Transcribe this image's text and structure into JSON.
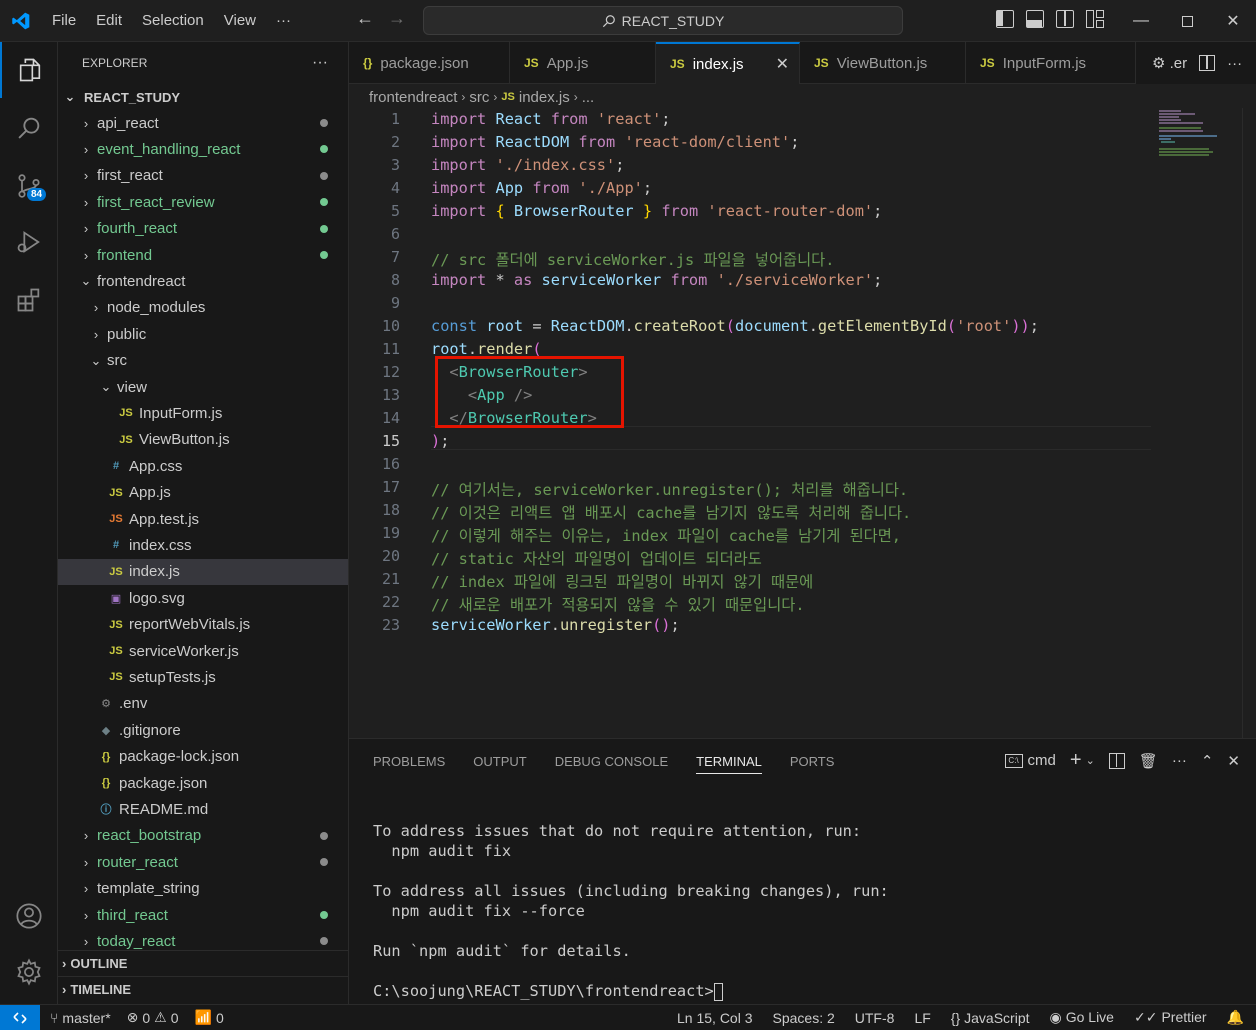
{
  "titlebar": {
    "menu": [
      "File",
      "Edit",
      "Selection",
      "View"
    ],
    "more": "···",
    "search_text": "REACT_STUDY"
  },
  "activitybar": {
    "scm_badge": "84"
  },
  "sidebar": {
    "title": "EXPLORER",
    "more": "···",
    "root": "REACT_STUDY",
    "items": [
      {
        "label": "api_react",
        "type": "folder",
        "level": 0,
        "open": false,
        "color": "#cccccc",
        "dot": "#8b8b8b"
      },
      {
        "label": "event_handling_react",
        "type": "folder",
        "level": 0,
        "open": false,
        "color": "#73c991",
        "dot": "#73c991"
      },
      {
        "label": "first_react",
        "type": "folder",
        "level": 0,
        "open": false,
        "color": "#cccccc",
        "dot": "#8b8b8b"
      },
      {
        "label": "first_react_review",
        "type": "folder",
        "level": 0,
        "open": false,
        "color": "#73c991",
        "dot": "#73c991"
      },
      {
        "label": "fourth_react",
        "type": "folder",
        "level": 0,
        "open": false,
        "color": "#73c991",
        "dot": "#73c991"
      },
      {
        "label": "frontend",
        "type": "folder",
        "level": 0,
        "open": false,
        "color": "#73c991",
        "dot": "#73c991"
      },
      {
        "label": "frontendreact",
        "type": "folder",
        "level": 0,
        "open": true,
        "color": "#cccccc",
        "dot": ""
      },
      {
        "label": "node_modules",
        "type": "folder",
        "level": 1,
        "open": false,
        "color": "#cccccc",
        "dot": ""
      },
      {
        "label": "public",
        "type": "folder",
        "level": 1,
        "open": false,
        "color": "#cccccc",
        "dot": ""
      },
      {
        "label": "src",
        "type": "folder",
        "level": 1,
        "open": true,
        "color": "#cccccc",
        "dot": ""
      },
      {
        "label": "view",
        "type": "folder",
        "level": 2,
        "open": true,
        "color": "#cccccc",
        "dot": ""
      },
      {
        "label": "InputForm.js",
        "type": "js",
        "level": 3,
        "color": "#cccccc",
        "dot": ""
      },
      {
        "label": "ViewButton.js",
        "type": "js",
        "level": 3,
        "color": "#cccccc",
        "dot": ""
      },
      {
        "label": "App.css",
        "type": "css",
        "level": 2,
        "color": "#cccccc",
        "dot": ""
      },
      {
        "label": "App.js",
        "type": "js",
        "level": 2,
        "color": "#cccccc",
        "dot": ""
      },
      {
        "label": "App.test.js",
        "type": "test",
        "level": 2,
        "color": "#cccccc",
        "dot": ""
      },
      {
        "label": "index.css",
        "type": "css",
        "level": 2,
        "color": "#cccccc",
        "dot": ""
      },
      {
        "label": "index.js",
        "type": "js",
        "level": 2,
        "color": "#cccccc",
        "dot": "",
        "selected": true
      },
      {
        "label": "logo.svg",
        "type": "svg",
        "level": 2,
        "color": "#cccccc",
        "dot": ""
      },
      {
        "label": "reportWebVitals.js",
        "type": "js",
        "level": 2,
        "color": "#cccccc",
        "dot": ""
      },
      {
        "label": "serviceWorker.js",
        "type": "js",
        "level": 2,
        "color": "#cccccc",
        "dot": ""
      },
      {
        "label": "setupTests.js",
        "type": "js",
        "level": 2,
        "color": "#cccccc",
        "dot": ""
      },
      {
        "label": ".env",
        "type": "env",
        "level": 1,
        "color": "#cccccc",
        "dot": ""
      },
      {
        "label": ".gitignore",
        "type": "git",
        "level": 1,
        "color": "#cccccc",
        "dot": ""
      },
      {
        "label": "package-lock.json",
        "type": "json",
        "level": 1,
        "color": "#cccccc",
        "dot": ""
      },
      {
        "label": "package.json",
        "type": "json",
        "level": 1,
        "color": "#cccccc",
        "dot": ""
      },
      {
        "label": "README.md",
        "type": "info",
        "level": 1,
        "color": "#cccccc",
        "dot": ""
      },
      {
        "label": "react_bootstrap",
        "type": "folder",
        "level": 0,
        "open": false,
        "color": "#73c991",
        "dot": "#8b8b8b"
      },
      {
        "label": "router_react",
        "type": "folder",
        "level": 0,
        "open": false,
        "color": "#73c991",
        "dot": "#8b8b8b"
      },
      {
        "label": "template_string",
        "type": "folder",
        "level": 0,
        "open": false,
        "color": "#cccccc",
        "dot": ""
      },
      {
        "label": "third_react",
        "type": "folder",
        "level": 0,
        "open": false,
        "color": "#73c991",
        "dot": "#73c991"
      },
      {
        "label": "today_react",
        "type": "folder",
        "level": 0,
        "open": false,
        "color": "#73c991",
        "dot": "#8b8b8b"
      }
    ],
    "outline": "OUTLINE",
    "timeline": "TIMELINE"
  },
  "tabs": [
    {
      "label": "package.json",
      "icon": "{}",
      "icon_color": "#cbcb41",
      "active": false
    },
    {
      "label": "App.js",
      "icon": "JS",
      "icon_color": "#cbcb41",
      "active": false
    },
    {
      "label": "index.js",
      "icon": "JS",
      "icon_color": "#cbcb41",
      "active": true
    },
    {
      "label": "ViewButton.js",
      "icon": "JS",
      "icon_color": "#cbcb41",
      "active": false
    },
    {
      "label": "InputForm.js",
      "icon": "JS",
      "icon_color": "#cbcb41",
      "active": false
    }
  ],
  "tab_overflow": ".er",
  "breadcrumb": [
    "frontendreact",
    "src",
    "index.js",
    "..."
  ],
  "editor": {
    "current_line": 15,
    "lines": [
      [
        [
          "kwc",
          "import "
        ],
        [
          "var",
          "React "
        ],
        [
          "kwc",
          "from "
        ],
        [
          "str",
          "'react'"
        ],
        [
          "",
          "；"
        ]
      ],
      [],
      [],
      [],
      [],
      [],
      [],
      [],
      [],
      [],
      [],
      [],
      [],
      [],
      [],
      [],
      [],
      [],
      [],
      [],
      [],
      [],
      []
    ]
  },
  "code_text": [
    "import React from 'react';",
    "import ReactDOM from 'react-dom/client';",
    "import './index.css';",
    "import App from './App';",
    "import { BrowserRouter } from 'react-router-dom';",
    "",
    "// src 폴더에 serviceWorker.js 파일을 넣어줍니다.",
    "import * as serviceWorker from './serviceWorker';",
    "",
    "const root = ReactDOM.createRoot(document.getElementById('root'));",
    "root.render(",
    "  <BrowserRouter>",
    "    <App />",
    "  </BrowserRouter>",
    ");",
    "",
    "// 여기서는, serviceWorker.unregister(); 처리를 해줍니다.",
    "// 이것은 리액트 앱 배포시 cache를 남기지 않도록 처리해 줍니다.",
    "// 이렇게 해주는 이유는, index 파일이 cache를 남기게 된다면,",
    "// static 자산의 파일명이 업데이트 되더라도",
    "// index 파일에 링크된 파일명이 바뀌지 않기 때문에",
    "// 새로운 배포가 적용되지 않을 수 있기 때문입니다.",
    "serviceWorker.unregister();"
  ],
  "panel": {
    "tabs": [
      "PROBLEMS",
      "OUTPUT",
      "DEBUG CONSOLE",
      "TERMINAL",
      "PORTS"
    ],
    "active_tab": "TERMINAL",
    "shell": "cmd",
    "terminal_lines": [
      "To address issues that do not require attention, run:",
      "  npm audit fix",
      "",
      "To address all issues (including breaking changes), run:",
      "  npm audit fix --force",
      "",
      "Run `npm audit` for details.",
      "",
      "C:\\soojung\\REACT_STUDY\\frontendreact>"
    ]
  },
  "statusbar": {
    "branch": "master*",
    "errors": "0",
    "warnings": "0",
    "ports": "0",
    "position": "Ln 15, Col 3",
    "spaces": "Spaces: 2",
    "encoding": "UTF-8",
    "eol": "LF",
    "language": "JavaScript",
    "golive": "Go Live",
    "prettier": "Prettier"
  },
  "colors": {
    "accent": "#0078d4",
    "highlight_box": "#e51400",
    "git_added": "#73c991"
  }
}
